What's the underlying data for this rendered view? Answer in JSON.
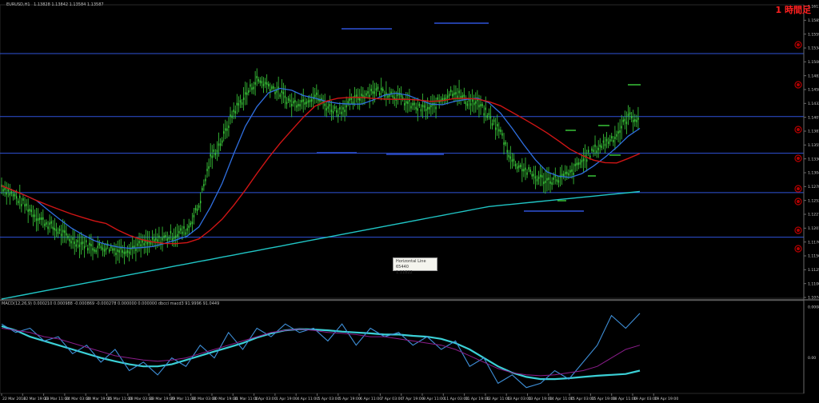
{
  "chart_data": [
    {
      "type": "line",
      "title": "EURUSD,H1",
      "header_values": "1.13828 1.13842 1.13584 1.13587",
      "ylim": [
        1.1085,
        1.164
      ],
      "y_ticks": [
        "1.16110",
        "1.15850",
        "1.15595",
        "1.15345",
        "1.15085",
        "1.14835",
        "1.14580",
        "1.14320",
        "1.14070",
        "1.13810",
        "1.13556",
        "1.13300",
        "1.13040",
        "1.12785",
        "1.12525",
        "1.12270",
        "1.12015",
        "1.11760",
        "1.11505",
        "1.11250",
        "1.11000",
        "1.10745"
      ],
      "x_labels": [
        "22 Mar 2016",
        "22 Mar 19:00",
        "23 Mar 11:00",
        "24 Mar 03:00",
        "24 Mar 19:00",
        "25 Mar 11:00",
        "28 Mar 03:00",
        "28 Mar 19:00",
        "29 Mar 11:00",
        "30 Mar 03:00",
        "30 Mar 19:00",
        "31 Mar 11:00",
        "1 Apr 03:00",
        "1 Apr 19:00",
        "4 Apr 11:00",
        "5 Apr 03:00",
        "5 Apr 19:00",
        "6 Apr 11:00",
        "7 Apr 03:00",
        "7 Apr 19:00",
        "8 Apr 11:00",
        "11 Apr 03:00",
        "11 Apr 19:00",
        "12 Apr 11:00",
        "13 Apr 03:00",
        "13 Apr 19:00",
        "14 Apr 11:00",
        "15 Apr 03:00",
        "15 Apr 19:00",
        "18 Apr 11:00",
        "19 Apr 03:00",
        "19 Apr 19:00"
      ],
      "price_close": [
        1.1298,
        1.128,
        1.1262,
        1.124,
        1.1225,
        1.121,
        1.1195,
        1.1188,
        1.118,
        1.1182,
        1.1175,
        1.1178,
        1.1185,
        1.119,
        1.1198,
        1.1205,
        1.1215,
        1.126,
        1.135,
        1.1385,
        1.144,
        1.147,
        1.15,
        1.149,
        1.1475,
        1.1455,
        1.146,
        1.147,
        1.145,
        1.144,
        1.1455,
        1.147,
        1.148,
        1.1478,
        1.147,
        1.1455,
        1.1445,
        1.1445,
        1.1465,
        1.148,
        1.146,
        1.1455,
        1.143,
        1.14,
        1.1345,
        1.133,
        1.1315,
        1.1308,
        1.1312,
        1.132,
        1.1345,
        1.1365,
        1.138,
        1.1395,
        1.143,
        1.1425
      ],
      "levels": [
        1.155,
        1.143,
        1.136,
        1.1285,
        1.12
      ],
      "series": [],
      "macd": {
        "header": "MACD(12,26,9) 0.000210 0.000988 -0.000869 -0.000278 0.000000 0.000000 dbcci macd3 91.9996 91.0449",
        "ylim": [
          -1,
          1
        ],
        "y_ticks": [
          "0.000848",
          "0.00"
        ],
        "series": [
          {
            "values": [
              0.55,
              0.45,
              0.3,
              0.2,
              0.1,
              0.0,
              -0.1,
              -0.2,
              -0.28,
              -0.35,
              -0.4,
              -0.4,
              -0.35,
              -0.25,
              -0.15,
              -0.05,
              0.05,
              0.15,
              0.28,
              0.38,
              0.45,
              0.48,
              0.47,
              0.45,
              0.42,
              0.4,
              0.38,
              0.35,
              0.35,
              0.32,
              0.3,
              0.25,
              0.15,
              0.0,
              -0.2,
              -0.4,
              -0.55,
              -0.65,
              -0.7,
              -0.7,
              -0.68,
              -0.65,
              -0.62,
              -0.6,
              -0.58,
              -0.5
            ]
          },
          {
            "values": [
              0.6,
              0.4,
              0.5,
              0.2,
              0.3,
              -0.1,
              0.1,
              -0.3,
              0.0,
              -0.5,
              -0.3,
              -0.6,
              -0.2,
              -0.4,
              0.1,
              -0.2,
              0.4,
              0.0,
              0.5,
              0.3,
              0.6,
              0.4,
              0.5,
              0.2,
              0.6,
              0.1,
              0.5,
              0.3,
              0.4,
              0.1,
              0.3,
              0.0,
              0.2,
              -0.4,
              -0.2,
              -0.8,
              -0.6,
              -0.9,
              -0.8,
              -0.5,
              -0.7,
              -0.3,
              0.1,
              0.8,
              0.5,
              0.85
            ]
          },
          {
            "values": [
              0.5,
              0.45,
              0.4,
              0.3,
              0.25,
              0.15,
              0.05,
              -0.05,
              -0.15,
              -0.2,
              -0.25,
              -0.28,
              -0.25,
              -0.2,
              -0.1,
              0.0,
              0.1,
              0.2,
              0.3,
              0.4,
              0.45,
              0.48,
              0.45,
              0.4,
              0.38,
              0.35,
              0.3,
              0.3,
              0.25,
              0.2,
              0.15,
              0.1,
              0.0,
              -0.15,
              -0.3,
              -0.45,
              -0.55,
              -0.6,
              -0.62,
              -0.6,
              -0.55,
              -0.5,
              -0.4,
              -0.2,
              0.0,
              0.1
            ]
          }
        ]
      }
    }
  ],
  "tag": {
    "text": "1 時間足"
  },
  "tooltip": {
    "line1": "Horizontal Line 65440",
    "line2": "1.11822"
  },
  "colors": {
    "candle": "#3cd23c",
    "ma_fast": "#2f6fe0",
    "ma_slow": "#d01515",
    "ma_long": "#20c6c6",
    "level": "#2f53d9",
    "macd_main": "#3bd0d6",
    "macd_signal": "#8b1d8b",
    "macd_fast": "#3e8fd8",
    "marker": "#b30000"
  }
}
